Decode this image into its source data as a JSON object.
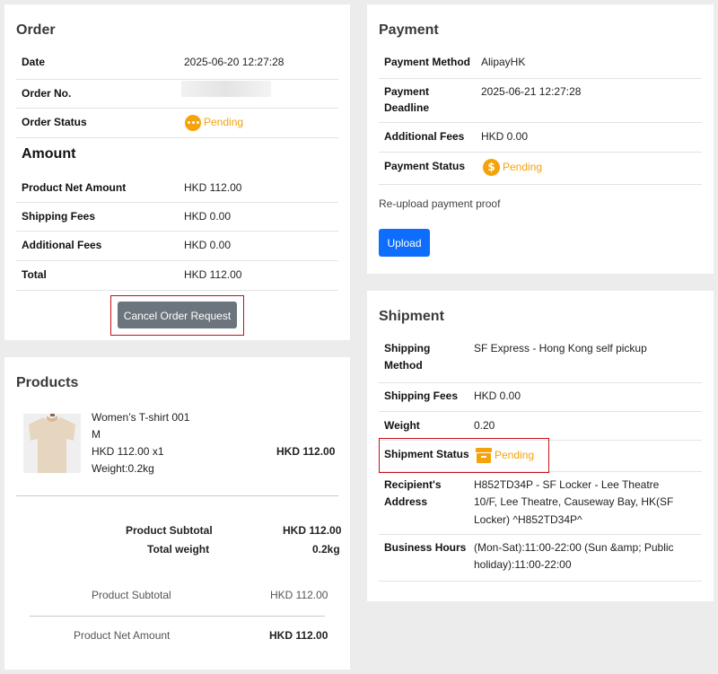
{
  "order": {
    "title": "Order",
    "date_label": "Date",
    "date_value": "2025-06-20 12:27:28",
    "order_no_label": "Order No.",
    "status_label": "Order Status",
    "status_value": "Pending",
    "amount_title": "Amount",
    "net_label": "Product Net Amount",
    "net_value": "HKD 112.00",
    "shipping_label": "Shipping Fees",
    "shipping_value": "HKD 0.00",
    "additional_label": "Additional Fees",
    "additional_value": "HKD 0.00",
    "total_label": "Total",
    "total_value": "HKD 112.00",
    "cancel_label": "Cancel Order Request"
  },
  "payment": {
    "title": "Payment",
    "method_label": "Payment Method",
    "method_value": "AlipayHK",
    "deadline_label_1": "Payment",
    "deadline_label_2": "Deadline",
    "deadline_value": "2025-06-21 12:27:28",
    "additional_label": "Additional Fees",
    "additional_value": "HKD 0.00",
    "status_label": "Payment Status",
    "status_value": "Pending",
    "reupload_text": "Re-upload payment proof",
    "upload_label": "Upload"
  },
  "products": {
    "title": "Products",
    "item": {
      "name": "Women’s T-shirt 001",
      "size": "M",
      "price_qty": "HKD 112.00 x1",
      "weight": "Weight:0.2kg",
      "line_total": "HKD 112.00"
    },
    "subtotal_label": "Product Subtotal",
    "subtotal_value": "HKD 112.00",
    "total_weight_label": "Total weight",
    "total_weight_value": "0.2kg",
    "subtotal2_label": "Product Subtotal",
    "subtotal2_value": "HKD 112.00",
    "net_label": "Product Net Amount",
    "net_value": "HKD 112.00"
  },
  "shipment": {
    "title": "Shipment",
    "method_label_1": "Shipping",
    "method_label_2": "Method",
    "method_value": "SF Express - Hong Kong self pickup",
    "fees_label": "Shipping Fees",
    "fees_value": "HKD 0.00",
    "weight_label": "Weight",
    "weight_value": "0.20",
    "status_label": "Shipment Status",
    "status_value": "Pending",
    "address_label_1": "Recipient's",
    "address_label_2": "Address",
    "address_line_1": "H852TD34P - SF Locker - Lee Theatre",
    "address_line_2": "10/F, Lee Theatre, Causeway Bay, HK(SF",
    "address_line_3": "Locker) ^H852TD34P^",
    "hours_label": "Business Hours",
    "hours_line_1": "(Mon-Sat):11:00-22:00 (Sun &amp; Public",
    "hours_line_2": "holiday):11:00-22:00"
  },
  "colors": {
    "pending": "#f5a20b",
    "upload": "#0d6efd",
    "cancel": "#6c757d",
    "highlight": "#c0101a"
  }
}
